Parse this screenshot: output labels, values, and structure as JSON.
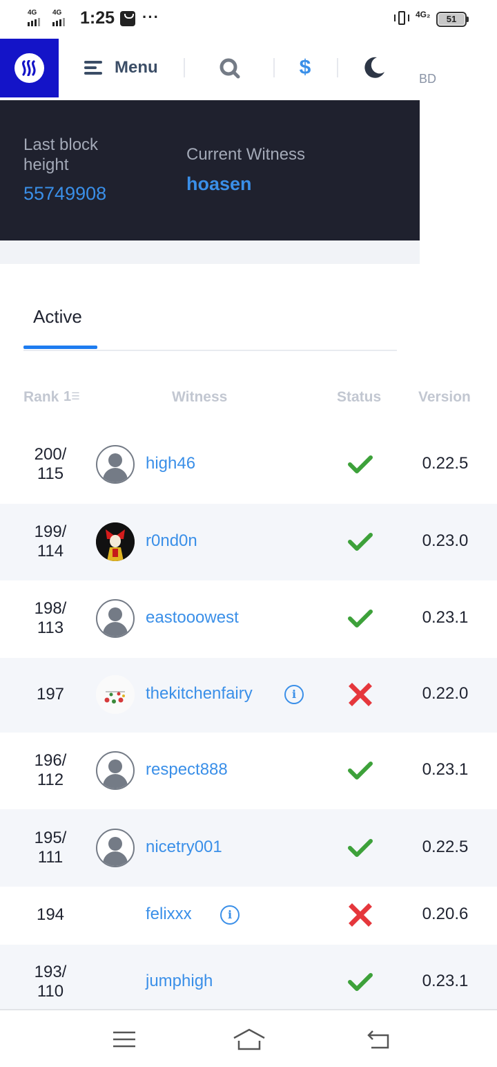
{
  "status_bar": {
    "network1": "4G",
    "network2": "4G",
    "time": "1:25",
    "more": "···",
    "network3": "4G₂",
    "battery": "51"
  },
  "nav": {
    "menu_label": "Menu",
    "dollar_label": "$",
    "partial_text": "BD"
  },
  "block_info": {
    "last_block_label": "Last block height",
    "last_block_value": "55749908",
    "current_witness_label": "Current Witness",
    "current_witness_value": "hoasen"
  },
  "tabs": {
    "active_label": "Active"
  },
  "table": {
    "headers": {
      "rank": "Rank",
      "witness": "Witness",
      "status": "Status",
      "version": "Version"
    },
    "rows": [
      {
        "rank1": "200/",
        "rank2": "115",
        "name": "high46",
        "status": "ok",
        "version": "0.22.5",
        "avatar": "default"
      },
      {
        "rank1": "199/",
        "rank2": "114",
        "name": "r0nd0n",
        "status": "ok",
        "version": "0.23.0",
        "avatar": "joker"
      },
      {
        "rank1": "198/",
        "rank2": "113",
        "name": "eastooowest",
        "status": "ok",
        "version": "0.23.1",
        "avatar": "default"
      },
      {
        "rank1": "197",
        "rank2": "",
        "name": "thekitchenfairy",
        "status": "disabled",
        "version": "0.22.0",
        "avatar": "kitchen"
      },
      {
        "rank1": "196/",
        "rank2": "112",
        "name": "respect888",
        "status": "ok",
        "version": "0.23.1",
        "avatar": "default"
      },
      {
        "rank1": "195/",
        "rank2": "111",
        "name": "nicetry001",
        "status": "ok",
        "version": "0.22.5",
        "avatar": "default"
      },
      {
        "rank1": "194",
        "rank2": "",
        "name": "felixxx",
        "status": "disabled",
        "version": "0.20.6",
        "avatar": "none"
      },
      {
        "rank1": "193/",
        "rank2": "110",
        "name": "jumphigh",
        "status": "ok",
        "version": "0.23.1",
        "avatar": "none"
      }
    ]
  },
  "colors": {
    "accent": "#3a8fe8",
    "logo_bg": "#1414c8",
    "panel_bg": "#1f212e",
    "status_ok": "#3da13a",
    "status_bad": "#e5373c"
  },
  "icons": {
    "logo": "steem-logo-icon",
    "menu": "hamburger-icon",
    "search": "search-icon",
    "currency": "dollar-icon",
    "theme": "moon-icon",
    "sort": "sort-ascending-icon",
    "ok": "check-icon",
    "bad": "cross-icon",
    "info": "info-icon"
  }
}
